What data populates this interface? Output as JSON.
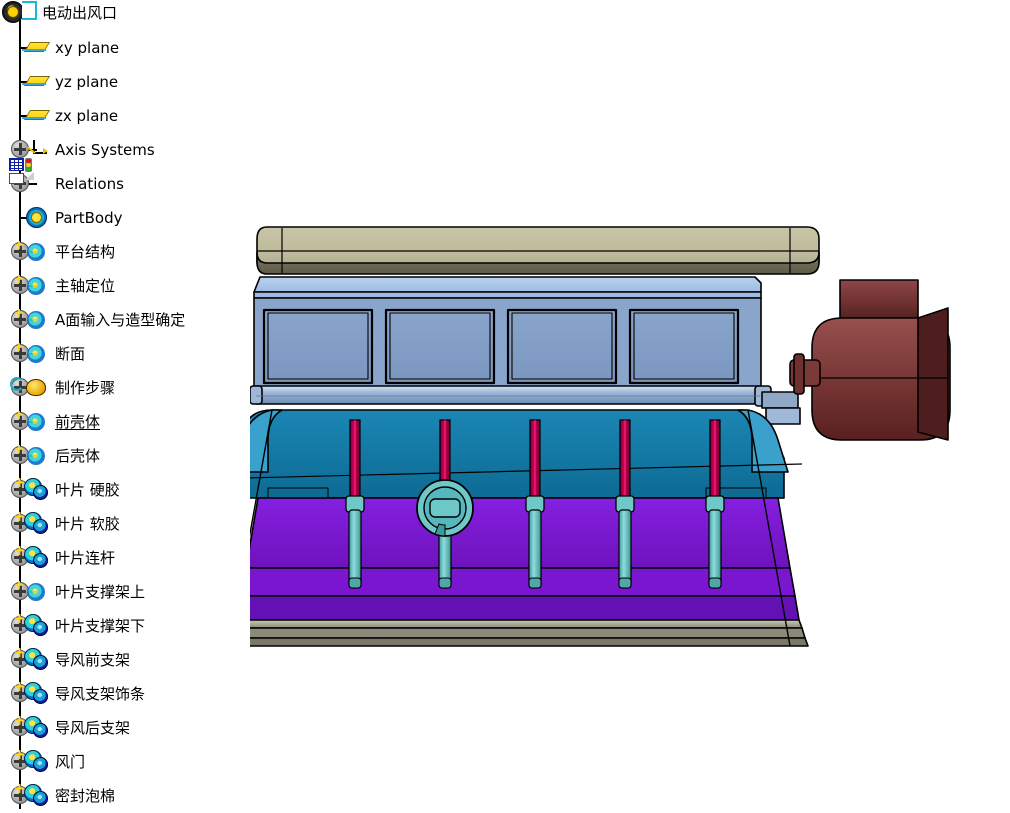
{
  "window": {
    "root_label": "电动出风口",
    "root_icon": "part-gear-icon"
  },
  "spec_tree": {
    "items": [
      {
        "label": "xy plane",
        "icon": "plane-icon",
        "expandable": false,
        "selected": false
      },
      {
        "label": "yz plane",
        "icon": "plane-icon",
        "expandable": false,
        "selected": false
      },
      {
        "label": "zx plane",
        "icon": "plane-icon",
        "expandable": false,
        "selected": false
      },
      {
        "label": "Axis Systems",
        "icon": "axis-system-icon",
        "expandable": true,
        "selected": false
      },
      {
        "label": "Relations",
        "icon": "relations-icon",
        "expandable": true,
        "selected": false
      },
      {
        "label": "PartBody",
        "icon": "part-body-icon",
        "expandable": false,
        "selected": false
      },
      {
        "label": "平台结构",
        "icon": "geometrical-set-icon",
        "expandable": true,
        "selected": false
      },
      {
        "label": "主轴定位",
        "icon": "geometrical-set-icon",
        "expandable": true,
        "selected": false
      },
      {
        "label": "A面输入与造型确定",
        "icon": "geometrical-set-icon",
        "expandable": true,
        "selected": false
      },
      {
        "label": "断面",
        "icon": "geometrical-set-icon",
        "expandable": true,
        "selected": false
      },
      {
        "label": "制作步骤",
        "icon": "ordered-set-icon",
        "expandable": true,
        "selected": false
      },
      {
        "label": "前壳体",
        "icon": "geometrical-set-icon",
        "expandable": true,
        "selected": true
      },
      {
        "label": "后壳体",
        "icon": "geometrical-set-icon",
        "expandable": true,
        "selected": false
      },
      {
        "label": "叶片 硬胶",
        "icon": "body-set-icon",
        "expandable": true,
        "selected": false
      },
      {
        "label": "叶片 软胶",
        "icon": "body-set-icon",
        "expandable": true,
        "selected": false
      },
      {
        "label": "叶片连杆",
        "icon": "body-set-icon",
        "expandable": true,
        "selected": false
      },
      {
        "label": "叶片支撑架上",
        "icon": "geometrical-set-icon",
        "expandable": true,
        "selected": false
      },
      {
        "label": "叶片支撑架下",
        "icon": "body-set-icon",
        "expandable": true,
        "selected": false
      },
      {
        "label": "导风前支架",
        "icon": "body-set-icon",
        "expandable": true,
        "selected": false
      },
      {
        "label": "导风支架饰条",
        "icon": "body-set-icon",
        "expandable": true,
        "selected": false
      },
      {
        "label": "导风后支架",
        "icon": "body-set-icon",
        "expandable": true,
        "selected": false
      },
      {
        "label": "风门",
        "icon": "body-set-icon",
        "expandable": true,
        "selected": false
      },
      {
        "label": "密封泡棉",
        "icon": "body-set-icon",
        "expandable": true,
        "selected": false
      }
    ]
  },
  "viewport": {
    "model_name": "电动出风口",
    "colors": {
      "top_cover": "#bdb99a",
      "top_cover_shadow": "#6e6b56",
      "vent_frame": "#aac6ea",
      "vent_panel": "#7e9ac2",
      "shell_upper": "#1277a2",
      "shell_highlight": "#3aa0cc",
      "shell_lower": "#7a16d0",
      "shell_lower_dark": "#5d10a8",
      "base_strip": "#8b8a7a",
      "motor": "#7d3a3a",
      "motor_dark": "#4a1f1f",
      "rod_upper": "#b4004e",
      "rod_lower": "#69c8c8",
      "outline": "#000000"
    },
    "blade_count": 5,
    "vent_panel_count": 4
  }
}
